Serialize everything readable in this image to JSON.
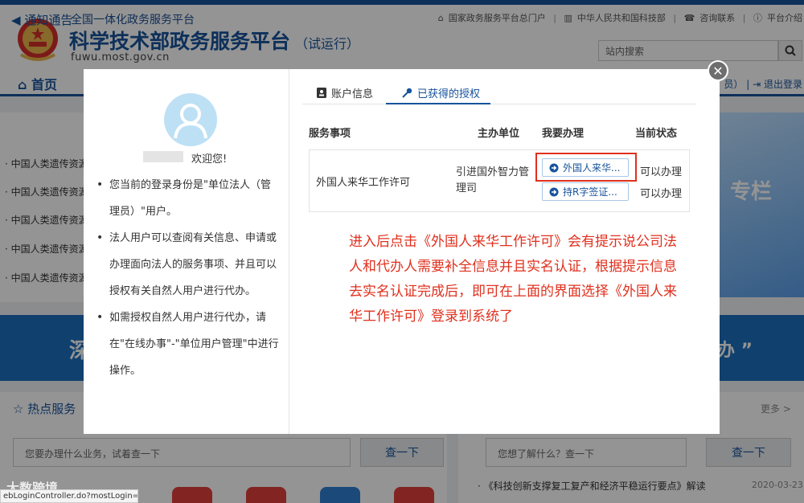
{
  "header": {
    "platform_label": "全国一体化政务服务平台",
    "site_title": "科学技术部政务服务平台",
    "site_title_note": "（试运行）",
    "site_url": "fuwu.most.gov.cn",
    "top_links": [
      "国家政务服务平台总门户",
      "中华人民共和国科技部",
      "咨询联系",
      "平台介绍"
    ],
    "search_placeholder": "站内搜索"
  },
  "nav": {
    "home": "首页",
    "partial_right": "员）",
    "logout": "退出登录"
  },
  "notice": {
    "title": "通知通告",
    "items": [
      "中国人类遗传资源",
      "中国人类遗传资源",
      "中国人类遗传资源",
      "中国人类遗传资源",
      "中国人类遗传资源"
    ]
  },
  "banner": {
    "text": "专栏"
  },
  "slogan": {
    "left": "深",
    "right": "办 ”"
  },
  "hot_services": {
    "title": "热点服务",
    "search_placeholder": "您要办理什么业务，试着查一下",
    "search_button": "查一下"
  },
  "right_column": {
    "more": "更多 >",
    "search_placeholder": "您想了解什么？查一下",
    "search_button": "查一下",
    "news_title": "《科技创新支撑复工复产和经济平稳运行要点》解读",
    "news_date": "2020-03-23"
  },
  "watermark": "大数跨境",
  "status_bar_url": "ebLoginController.do?mostLogin=true",
  "modal": {
    "welcome": "欢迎您!",
    "info": [
      "您当前的登录身份是\"单位法人（管理员）\"用户。",
      "法人用户可以查阅有关信息、申请或办理面向法人的服务事项、并且可以授权有关自然人用户进行代办。",
      "如需授权自然人用户进行代办，请在\"在线办事\"-\"单位用户管理\"中进行操作。"
    ],
    "tabs": {
      "account": "账户信息",
      "authorized": "已获得的授权"
    },
    "table": {
      "headers": [
        "服务事项",
        "主办单位",
        "我要办理",
        "当前状态"
      ],
      "row": {
        "service": "外国人来华工作许可",
        "organizer": "引进国外智力管理司",
        "actions": [
          "外国人来华...",
          "持R字签证..."
        ],
        "statuses": [
          "可以办理",
          "可以办理"
        ]
      }
    },
    "annotation": "进入后点击《外国人来华工作许可》会有提示说公司法人和代办人需要补全信息并且实名认证，根据提示信息去实名认证完成后，即可在上面的界面选择《外国人来华工作许可》登录到系统了"
  },
  "colors": {
    "primary": "#17539b",
    "highlight": "#e0301e",
    "avatar_bg": "#bde0f5"
  }
}
